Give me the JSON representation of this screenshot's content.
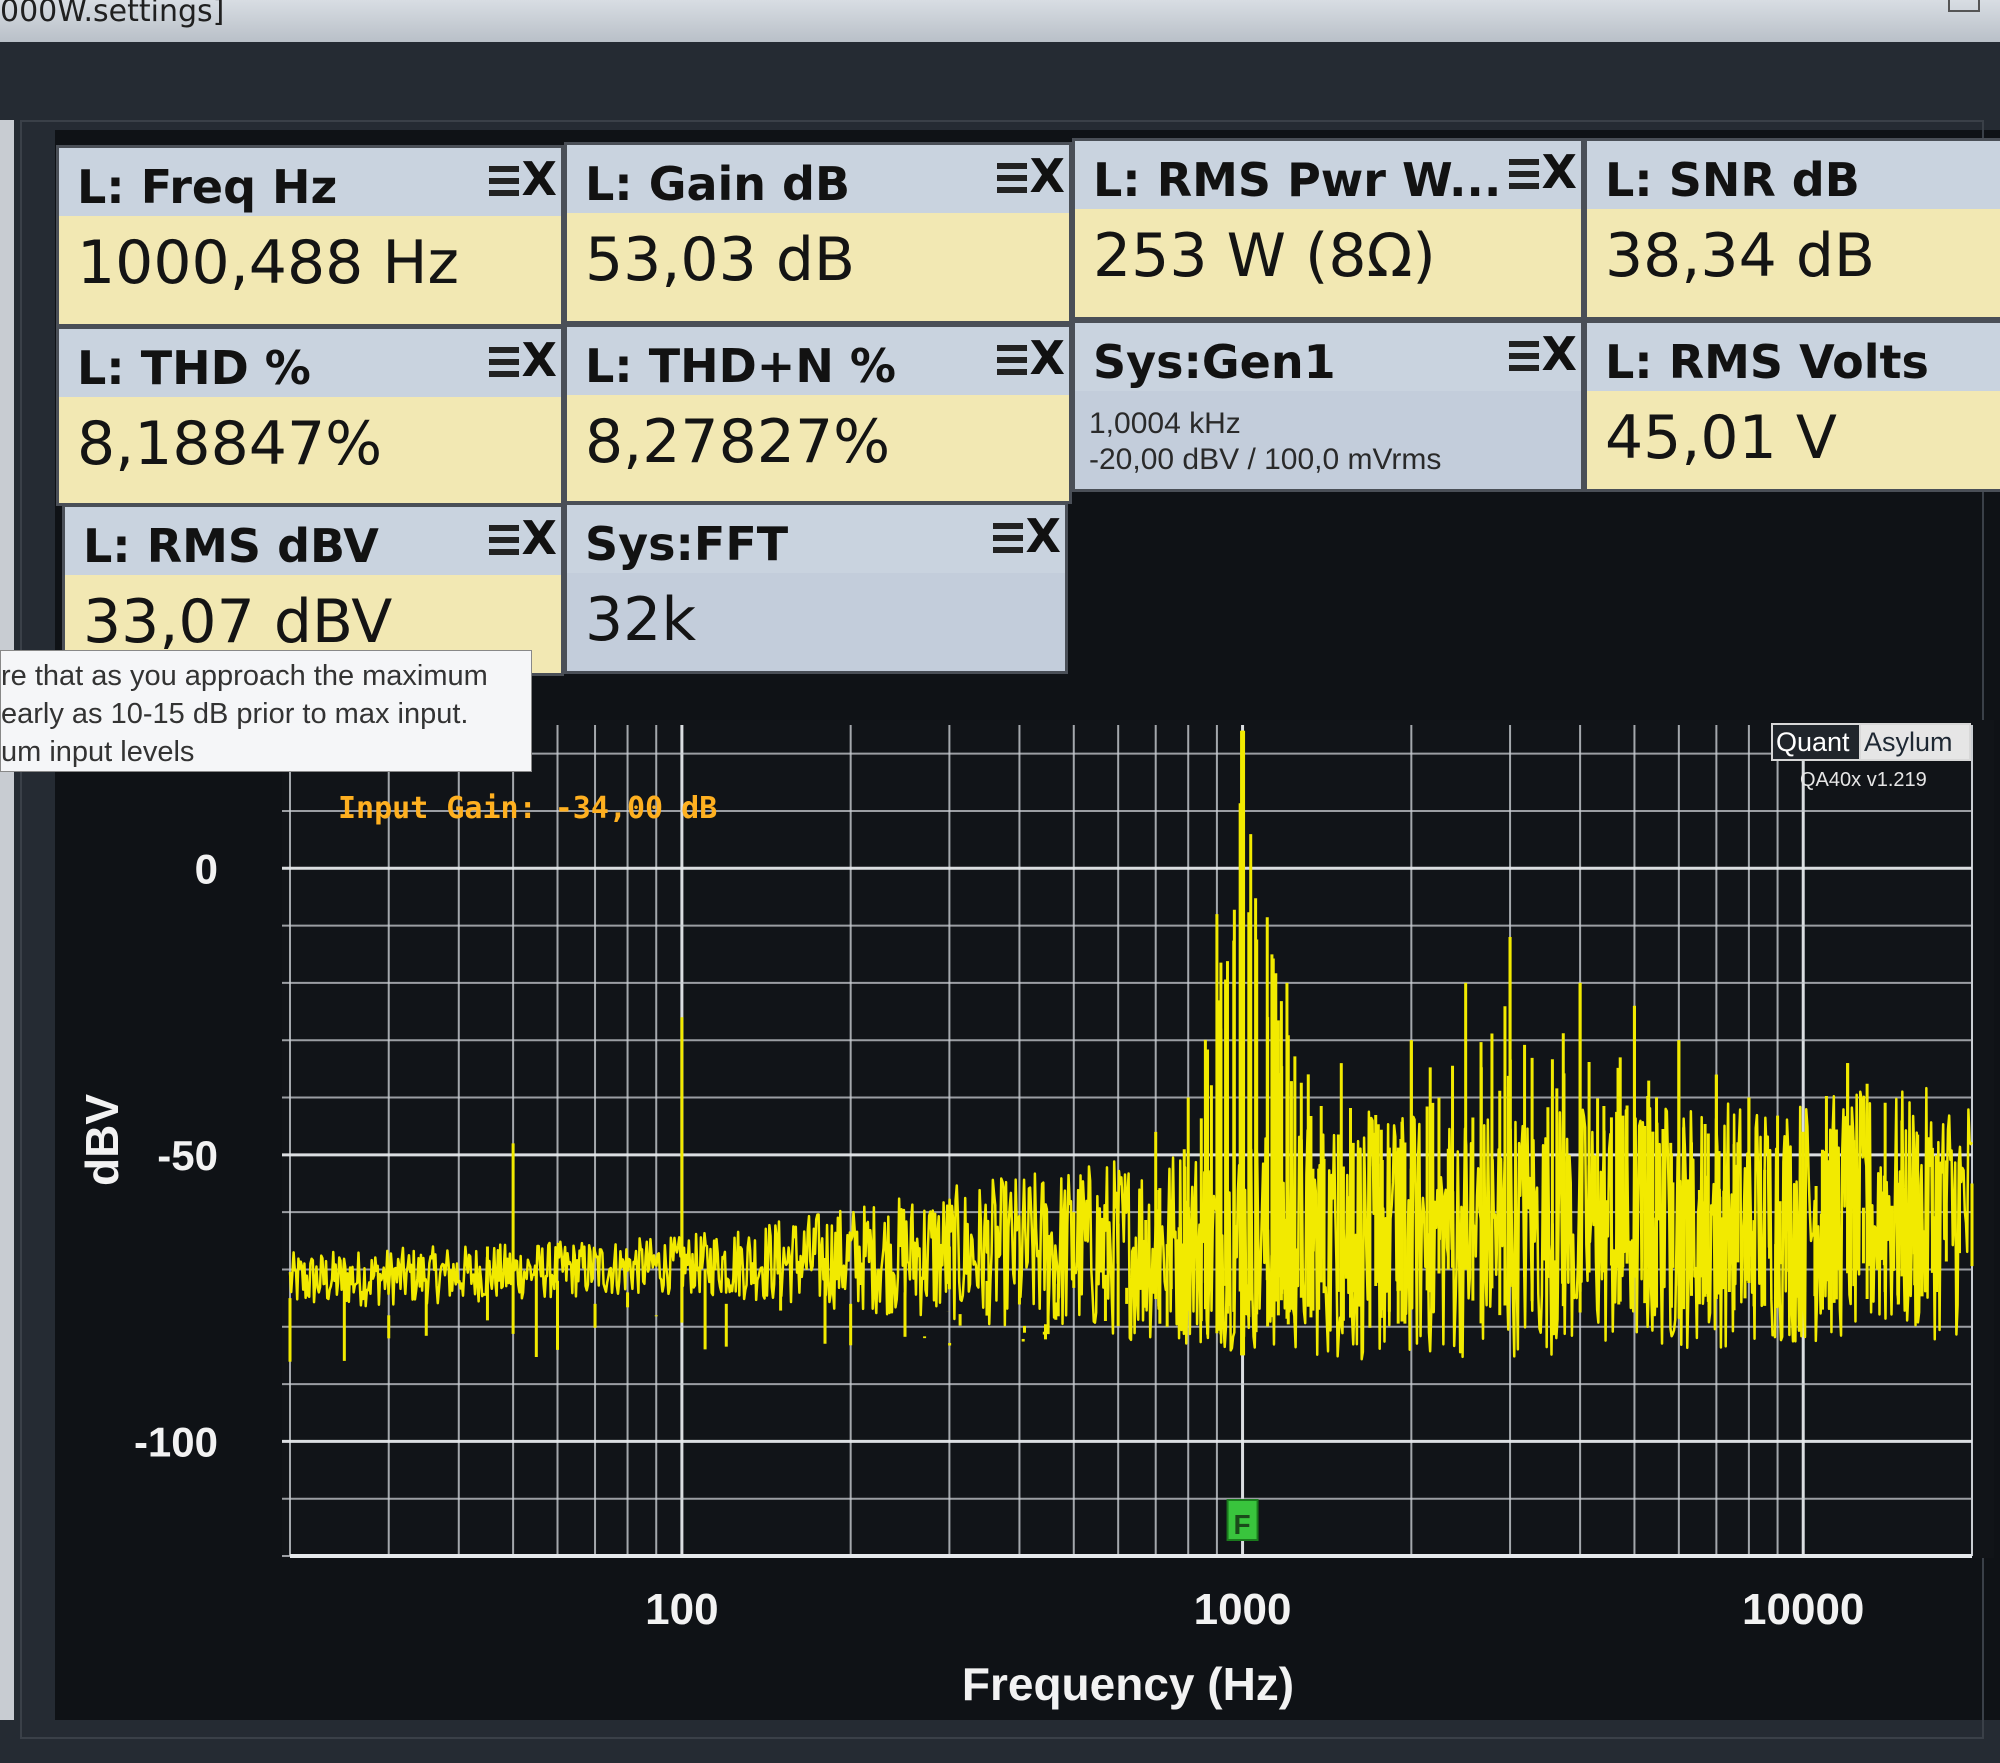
{
  "window": {
    "title_fragment": "000W.settings]"
  },
  "tiles": [
    {
      "title": "L: Freq Hz",
      "value": "1000,488 Hz"
    },
    {
      "title": "L: Gain dB",
      "value": "53,03 dB"
    },
    {
      "title": "L: RMS Pwr W...",
      "value": "253 W (8Ω)"
    },
    {
      "title": "L: SNR dB",
      "value": "38,34 dB"
    },
    {
      "title": "L: THD %",
      "value": "8,18847%"
    },
    {
      "title": "L: THD+N %",
      "value": "8,27827%"
    },
    {
      "title": "Sys:Gen1",
      "line1": "1,0004 kHz",
      "line2": "-20,00 dBV / 100,0 mVrms"
    },
    {
      "title": "L: RMS Volts",
      "value": "45,01 V"
    },
    {
      "title": "L: RMS dBV",
      "value": "33,07 dBV"
    },
    {
      "title": "Sys:FFT",
      "value": "32k"
    }
  ],
  "tile_icons": {
    "menu": "menu-icon",
    "close": "close-icon",
    "close_glyph": "X"
  },
  "tooltip": {
    "lines": [
      "re that as you approach the maximum",
      "early as 10-15 dB prior to max input.",
      "um input levels"
    ]
  },
  "chart": {
    "annotation": "Input Gain: -34,00 dB",
    "brand_left": "Quant",
    "brand_right": "Asylum",
    "version": "QA40x v1.219",
    "marker_label": "F"
  },
  "colors": {
    "trace": "#f2ea00",
    "grid": "#c9cdd2",
    "annotation": "#ffb020",
    "marker": "#39c43d",
    "plot_bg": "#111418"
  },
  "chart_data": {
    "type": "line",
    "title": "",
    "xlabel": "Frequency (Hz)",
    "ylabel": "dBV",
    "x_scale": "log",
    "xlim": [
      20,
      20000
    ],
    "ylim": [
      -120,
      25
    ],
    "x_ticks": [
      100,
      1000,
      10000
    ],
    "y_ticks": [
      0,
      -50,
      -100
    ],
    "grid": true,
    "fundamental_hz": 1000,
    "series": [
      {
        "name": "",
        "x": [
          20,
          25,
          30,
          35,
          40,
          45,
          50,
          55,
          60,
          70,
          80,
          90,
          100,
          110,
          120,
          150,
          180,
          200,
          250,
          300,
          350,
          400,
          450,
          500,
          600,
          700,
          800,
          900,
          1000,
          1200,
          1500,
          2000,
          2500,
          3000,
          4000,
          5000,
          6000,
          7000,
          8000,
          10000,
          12000,
          15000,
          20000
        ],
        "y": [
          -75,
          -70,
          -78,
          -72,
          -86,
          -66,
          -48,
          -70,
          -72,
          -76,
          -74,
          -78,
          -26,
          -70,
          -76,
          -72,
          -68,
          -76,
          -74,
          -66,
          -72,
          -70,
          -64,
          -60,
          -62,
          -46,
          -40,
          -8,
          24,
          -20,
          -34,
          -30,
          -20,
          -12,
          -20,
          -24,
          -30,
          -36,
          -40,
          -46,
          -34,
          -44,
          -55
        ]
      }
    ]
  }
}
